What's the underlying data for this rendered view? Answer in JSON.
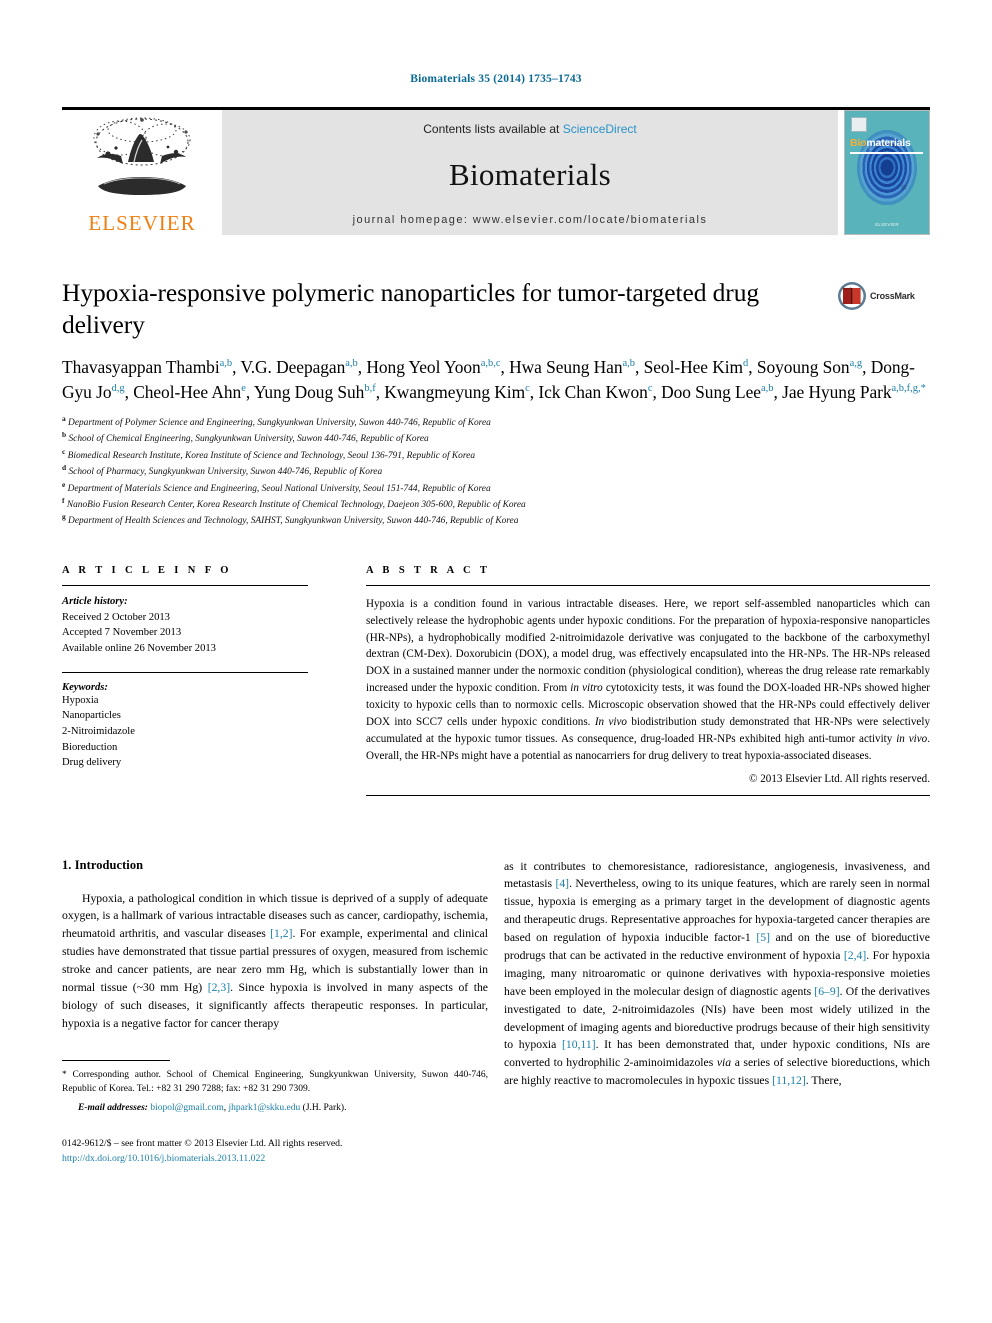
{
  "running_head": "Biomaterials 35 (2014) 1735–1743",
  "masthead": {
    "publisher_word": "ELSEVIER",
    "contents_prefix": "Contents lists available at",
    "contents_link": "ScienceDirect",
    "journal_name": "Biomaterials",
    "homepage": "journal homepage: www.elsevier.com/locate/biomaterials",
    "cover": {
      "title_part1": "Bio",
      "title_part2": "materials",
      "footer": "ELSEVIER"
    }
  },
  "article": {
    "title": "Hypoxia-responsive polymeric nanoparticles for tumor-targeted drug delivery",
    "crossmark_label": "CrossMark",
    "authors_line1_a": "Thavasyappan Thambi",
    "authors_line1_a_sup": "a,b",
    "authors_line1_b": ", V.G. Deepagan",
    "authors_line1_b_sup": "a,b",
    "authors_line1_c": ", Hong Yeol Yoon",
    "authors_line1_c_sup": "a,b,c",
    "authors_line1_d": ", Hwa Seung Han",
    "authors_line1_d_sup": "a,b",
    "authors_line2_a": ", Seol-Hee Kim",
    "authors_line2_a_sup": "d",
    "authors_line2_b": ", Soyoung Son",
    "authors_line2_b_sup": "a,g",
    "authors_line2_c": ", Dong-Gyu Jo",
    "authors_line2_c_sup": "d,g",
    "authors_line2_d": ", Cheol-Hee Ahn",
    "authors_line2_d_sup": "e",
    "authors_line2_e": ", Yung Doug Suh",
    "authors_line2_e_sup": "b,f",
    "authors_line3_a": ", Kwangmeyung Kim",
    "authors_line3_a_sup": "c",
    "authors_line3_b": ", Ick Chan Kwon",
    "authors_line3_b_sup": "c",
    "authors_line3_c": ", Doo Sung Lee",
    "authors_line3_c_sup": "a,b",
    "authors_line3_d": ", Jae Hyung Park",
    "authors_line3_d_sup": "a,b,f,g,*",
    "affiliations": [
      {
        "marker": "a",
        "text": "Department of Polymer Science and Engineering, Sungkyunkwan University, Suwon 440-746, Republic of Korea"
      },
      {
        "marker": "b",
        "text": "School of Chemical Engineering, Sungkyunkwan University, Suwon 440-746, Republic of Korea"
      },
      {
        "marker": "c",
        "text": "Biomedical Research Institute, Korea Institute of Science and Technology, Seoul 136-791, Republic of Korea"
      },
      {
        "marker": "d",
        "text": "School of Pharmacy, Sungkyunkwan University, Suwon 440-746, Republic of Korea"
      },
      {
        "marker": "e",
        "text": "Department of Materials Science and Engineering, Seoul National University, Seoul 151-744, Republic of Korea"
      },
      {
        "marker": "f",
        "text": "NanoBio Fusion Research Center, Korea Research Institute of Chemical Technology, Daejeon 305-600, Republic of Korea"
      },
      {
        "marker": "g",
        "text": "Department of Health Sciences and Technology, SAIHST, Sungkyunkwan University, Suwon 440-746, Republic of Korea"
      }
    ]
  },
  "article_info": {
    "heading": "A R T I C L E   I N F O",
    "history_label": "Article history:",
    "history": [
      "Received 2 October 2013",
      "Accepted 7 November 2013",
      "Available online 26 November 2013"
    ],
    "keywords_label": "Keywords:",
    "keywords": [
      "Hypoxia",
      "Nanoparticles",
      "2-Nitroimidazole",
      "Bioreduction",
      "Drug delivery"
    ]
  },
  "abstract": {
    "heading": "A B S T R A C T",
    "text": "Hypoxia is a condition found in various intractable diseases. Here, we report self-assembled nanoparticles which can selectively release the hydrophobic agents under hypoxic conditions. For the preparation of hypoxia-responsive nanoparticles (HR-NPs), a hydrophobically modified 2-nitroimidazole derivative was conjugated to the backbone of the carboxymethyl dextran (CM-Dex). Doxorubicin (DOX), a model drug, was effectively encapsulated into the HR-NPs. The HR-NPs released DOX in a sustained manner under the normoxic condition (physiological condition), whereas the drug release rate remarkably increased under the hypoxic condition. From in vitro cytotoxicity tests, it was found the DOX-loaded HR-NPs showed higher toxicity to hypoxic cells than to normoxic cells. Microscopic observation showed that the HR-NPs could effectively deliver DOX into SCC7 cells under hypoxic conditions. In vivo biodistribution study demonstrated that HR-NPs were selectively accumulated at the hypoxic tumor tissues. As consequence, drug-loaded HR-NPs exhibited high anti-tumor activity in vivo. Overall, the HR-NPs might have a potential as nanocarriers for drug delivery to treat hypoxia-associated diseases.",
    "copyright": "© 2013 Elsevier Ltd. All rights reserved."
  },
  "introduction": {
    "heading": "1.  Introduction",
    "left_paragraph": "Hypoxia, a pathological condition in which tissue is deprived of a supply of adequate oxygen, is a hallmark of various intractable diseases such as cancer, cardiopathy, ischemia, rheumatoid arthritis, and vascular diseases [1,2]. For example, experimental and clinical studies have demonstrated that tissue partial pressures of oxygen, measured from ischemic stroke and cancer patients, are near zero mm Hg, which is substantially lower than in normal tissue (~30 mm Hg) [2,3]. Since hypoxia is involved in many aspects of the biology of such diseases, it significantly affects therapeutic responses. In particular, hypoxia is a negative factor for cancer therapy",
    "right_paragraph": "as it contributes to chemoresistance, radioresistance, angiogenesis, invasiveness, and metastasis [4]. Nevertheless, owing to its unique features, which are rarely seen in normal tissue, hypoxia is emerging as a primary target in the development of diagnostic agents and therapeutic drugs. Representative approaches for hypoxia-targeted cancer therapies are based on regulation of hypoxia inducible factor-1 [5] and on the use of bioreductive prodrugs that can be activated in the reductive environment of hypoxia [2,4]. For hypoxia imaging, many nitroaromatic or quinone derivatives with hypoxia-responsive moieties have been employed in the molecular design of diagnostic agents [6–9]. Of the derivatives investigated to date, 2-nitroimidazoles (NIs) have been most widely utilized in the development of imaging agents and bioreductive prodrugs because of their high sensitivity to hypoxia [10,11]. It has been demonstrated that, under hypoxic conditions, NIs are converted to hydrophilic 2-aminoimidazoles via a series of selective bioreductions, which are highly reactive to macromolecules in hypoxic tissues [11,12]. There,"
  },
  "footnote": {
    "corresponding": "* Corresponding author. School of Chemical Engineering, Sungkyunkwan University, Suwon 440-746, Republic of Korea. Tel.: +82 31 290 7288; fax: +82 31 290 7309.",
    "email_label": "E-mail addresses:",
    "email1": "biopol@gmail.com",
    "email2": "jhpark1@skku.edu",
    "email_suffix": "(J.H. Park).",
    "issn_line": "0142-9612/$ – see front matter © 2013 Elsevier Ltd. All rights reserved.",
    "doi": "http://dx.doi.org/10.1016/j.biomaterials.2013.11.022"
  },
  "colors": {
    "link": "#1a7fa8",
    "running_head": "#0a6a96",
    "elsevier_orange": "#f07e10",
    "masthead_grey": "#e3e3e3"
  }
}
